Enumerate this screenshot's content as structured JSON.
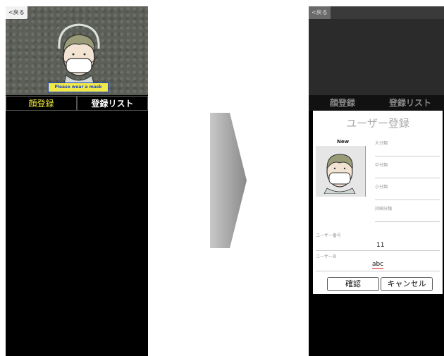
{
  "left": {
    "back_label": "<戻る",
    "detect_label": "Please wear a mask",
    "tabs": [
      {
        "label": "顔登録",
        "active": true
      },
      {
        "label": "登録リスト",
        "active": false
      }
    ]
  },
  "right": {
    "back_label": "<戻る",
    "tabs": [
      {
        "label": "顔登録"
      },
      {
        "label": "登録リスト"
      }
    ],
    "form": {
      "title": "ユーザー登録",
      "new_label": "New",
      "category_large": "大分類",
      "category_medium": "中分類",
      "category_small": "小分類",
      "category_detail": "詳細分類",
      "user_number_label": "ユーザー番号",
      "user_number_value": "11",
      "user_name_label": "ユーザー名",
      "user_name_value": "abc",
      "confirm_button": "確認",
      "cancel_button": "キャンセル"
    }
  },
  "colors": {
    "active_tab": "#f1e63a",
    "detect_label_bg": "#f1e84a",
    "detect_label_text": "#1f46c8"
  }
}
